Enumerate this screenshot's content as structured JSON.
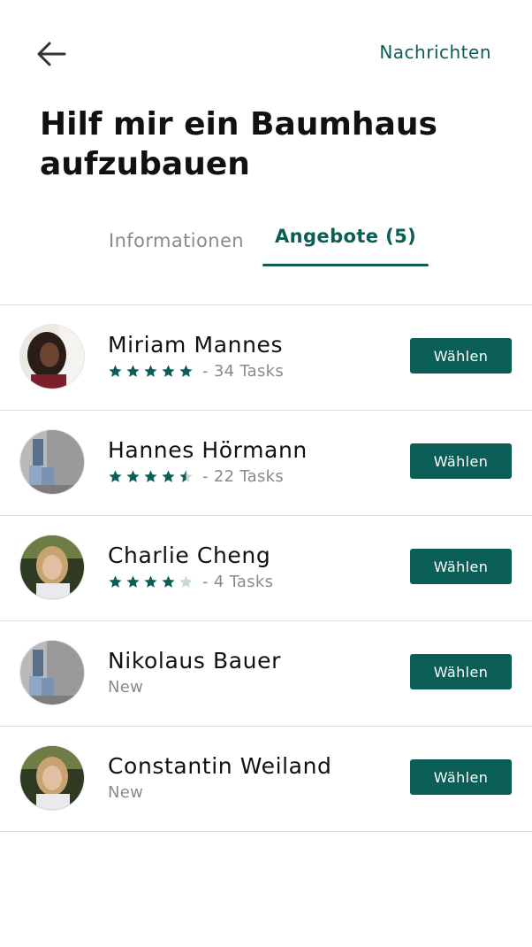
{
  "header": {
    "back_icon": "arrow-left-icon",
    "messages_label": "Nachrichten",
    "title": "Hilf mir ein Baumhaus aufzubauen"
  },
  "tabs": [
    {
      "label": "Informationen",
      "active": false
    },
    {
      "label": "Angebote (5)",
      "active": true
    }
  ],
  "colors": {
    "accent": "#0b5e55",
    "star_filled": "#0b5e55",
    "star_empty": "#c8d6d4",
    "muted_text": "#8a8a8a",
    "divider": "#dcdcdc"
  },
  "offers": [
    {
      "name": "Miriam Mannes",
      "rating": 5,
      "tasks": "- 34 Tasks",
      "status": "",
      "button": "Wählen",
      "avatar": "miriam"
    },
    {
      "name": "Hannes Hörmann",
      "rating": 4.5,
      "tasks": "- 22 Tasks",
      "status": "",
      "button": "Wählen",
      "avatar": "wall"
    },
    {
      "name": "Charlie Cheng",
      "rating": 4,
      "tasks": "- 4 Tasks",
      "status": "",
      "button": "Wählen",
      "avatar": "blonde"
    },
    {
      "name": "Nikolaus Bauer",
      "rating": null,
      "tasks": "",
      "status": "New",
      "button": "Wählen",
      "avatar": "wall"
    },
    {
      "name": "Constantin Weiland",
      "rating": null,
      "tasks": "",
      "status": "New",
      "button": "Wählen",
      "avatar": "blonde"
    }
  ]
}
